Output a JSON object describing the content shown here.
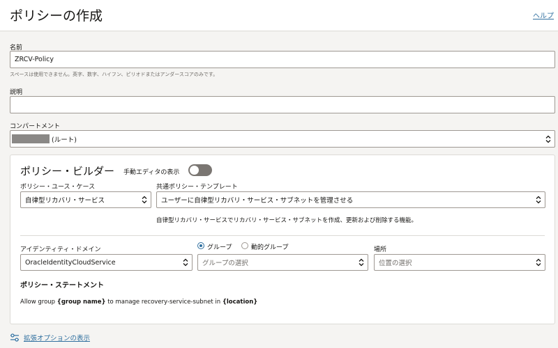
{
  "header": {
    "title": "ポリシーの作成",
    "help_label": "ヘルプ"
  },
  "form": {
    "name": {
      "label": "名前",
      "value": "ZRCV-Policy",
      "hint": "スペースは使用できません。英字、数字、ハイフン、ピリオドまたはアンダースコアのみです。"
    },
    "description": {
      "label": "説明",
      "value": ""
    },
    "compartment": {
      "label": "コンパートメント",
      "value": "(ルート)"
    }
  },
  "builder": {
    "title": "ポリシー・ビルダー",
    "manual_editor_label": "手動エディタの表示",
    "manual_editor_on": false,
    "use_case": {
      "label": "ポリシー・ユース・ケース",
      "value": "自律型リカバリ・サービス"
    },
    "template": {
      "label": "共通ポリシー・テンプレート",
      "value": "ユーザーに自律型リカバリ・サービス・サブネットを管理させる",
      "description": "自律型リカバリ・サービスでリカバリ・サービス・サブネットを作成、更新および削除する機能。"
    },
    "identity_domain": {
      "label": "アイデンティティ・ドメイン",
      "value": "OracleIdentityCloudService"
    },
    "group_type": {
      "options": [
        "グループ",
        "動的グループ"
      ],
      "selected": "グループ"
    },
    "group": {
      "placeholder": "グループの選択"
    },
    "location": {
      "label": "場所",
      "placeholder": "位置の選択"
    },
    "statement": {
      "title": "ポリシー・ステートメント",
      "prefix": "Allow group ",
      "group_token": "{group name}",
      "middle": " to manage recovery-service-subnet in ",
      "location_token": "{location}"
    }
  },
  "footer": {
    "advanced_label": "拡張オプションの表示"
  },
  "colors": {
    "accent": "#2f6f9f",
    "border": "#9e9892",
    "toggle_off": "#7a7672"
  }
}
